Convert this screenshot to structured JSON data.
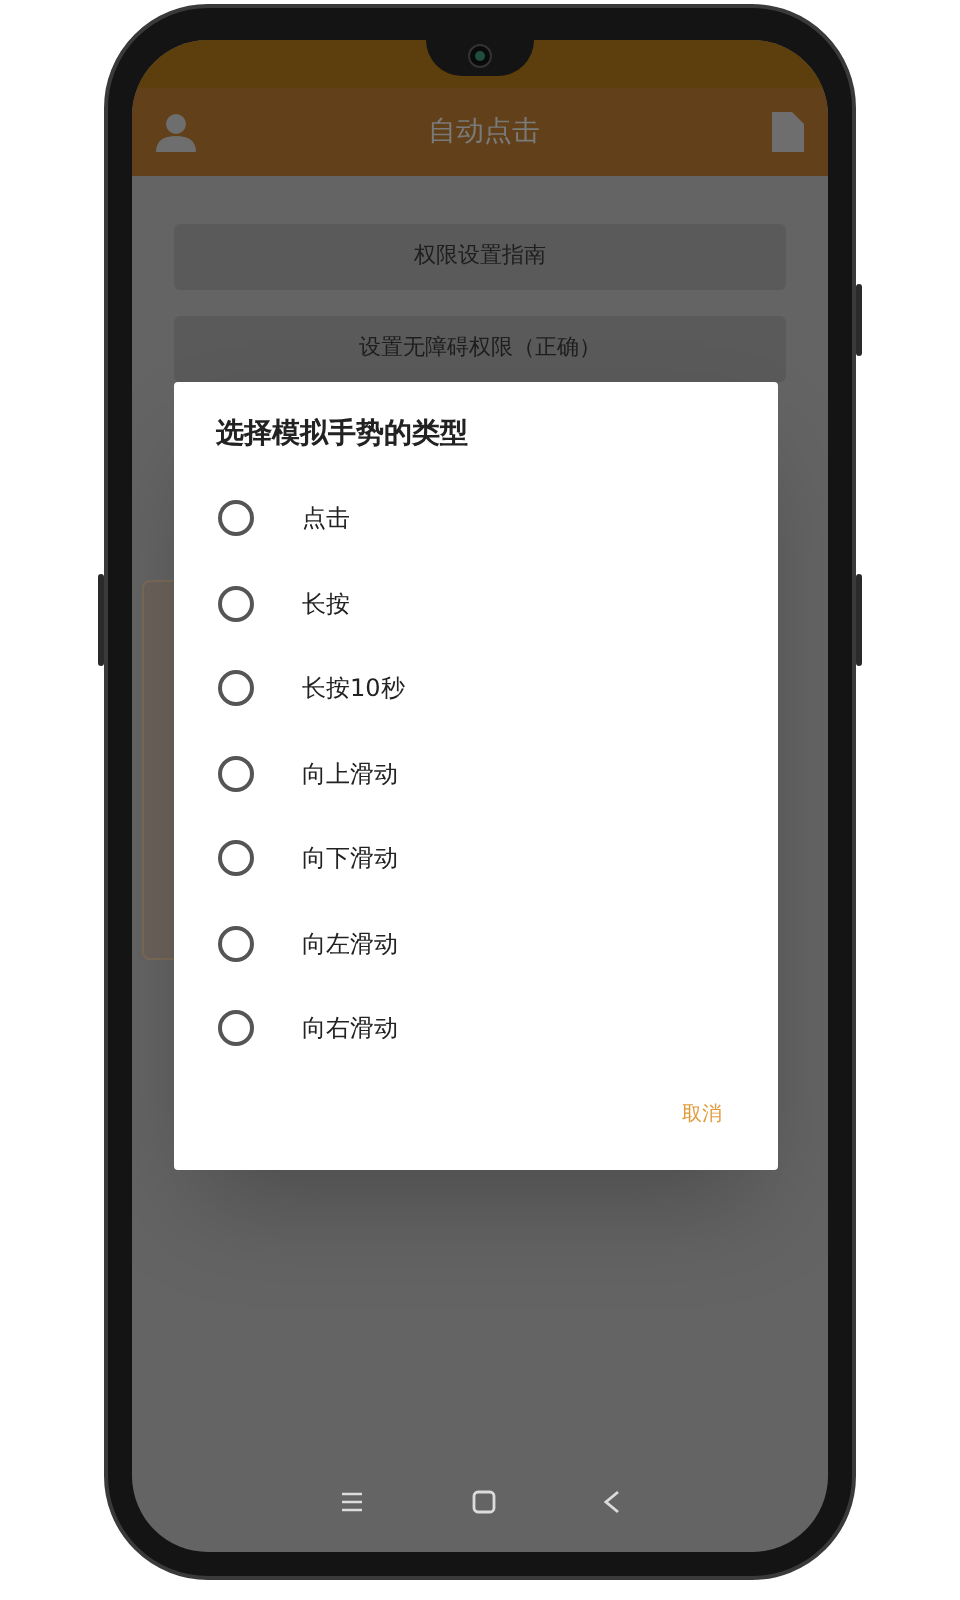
{
  "app_bar": {
    "title": "自动点击"
  },
  "buttons": [
    "权限设置指南",
    "设置无障碍权限（正确）"
  ],
  "dialog": {
    "title": "选择模拟手势的类型",
    "options": [
      {
        "label": "点击",
        "selected": false
      },
      {
        "label": "长按",
        "selected": false
      },
      {
        "label": "长按10秒",
        "selected": false
      },
      {
        "label": "向上滑动",
        "selected": false
      },
      {
        "label": "向下滑动",
        "selected": false
      },
      {
        "label": "向左滑动",
        "selected": false
      },
      {
        "label": "向右滑动",
        "selected": false
      }
    ],
    "actions": [
      "取消"
    ]
  }
}
